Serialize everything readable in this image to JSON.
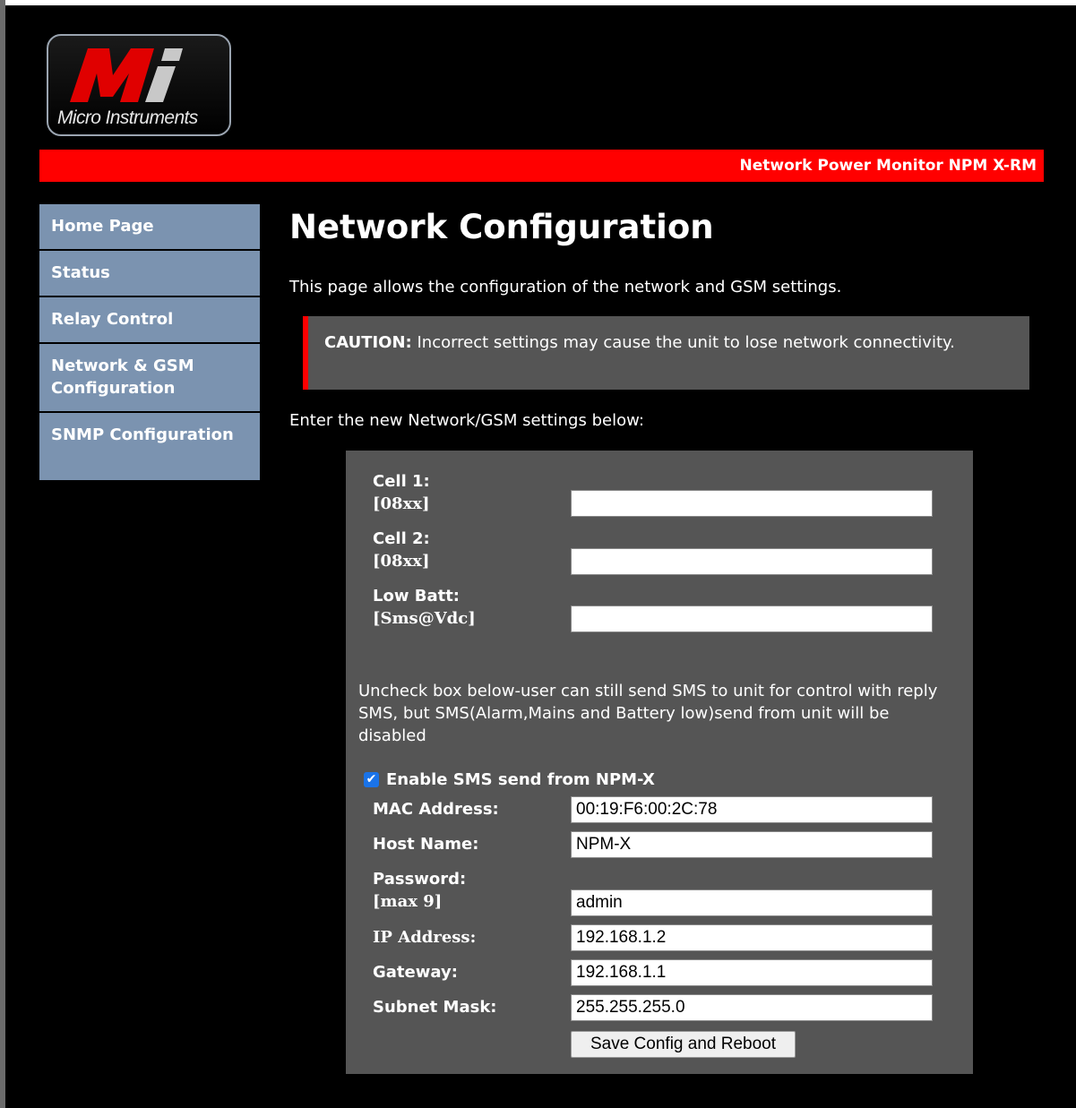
{
  "logo": {
    "mark": "Mi",
    "text": "Micro Instruments"
  },
  "banner": {
    "product": "Network Power Monitor NPM X-RM",
    "color": "#ff0000"
  },
  "nav": {
    "items": [
      {
        "label": "Home Page"
      },
      {
        "label": "Status"
      },
      {
        "label": "Relay Control"
      },
      {
        "label": "Network & GSM Configuration"
      },
      {
        "label": "SNMP Configuration"
      }
    ]
  },
  "main": {
    "title": "Network Configuration",
    "intro": "This page allows the configuration of the network and GSM settings.",
    "caution_label": "CAUTION:",
    "caution_text": " Incorrect settings may cause the unit to lose network connectivity.",
    "prompt": "Enter the new Network/GSM settings below:"
  },
  "form": {
    "cell1": {
      "label": "Cell 1:",
      "hint": "[08xx]",
      "value": ""
    },
    "cell2": {
      "label": "Cell 2:",
      "hint": "[08xx]",
      "value": ""
    },
    "lowbatt": {
      "label": "Low Batt:",
      "hint": "[Sms@Vdc]",
      "value": ""
    },
    "note": "Uncheck box below-user can still send SMS to unit for control with reply SMS, but SMS(Alarm,Mains and Battery low)send from unit will be disabled",
    "sms_enable": {
      "label": "Enable SMS send from NPM-X",
      "checked": true
    },
    "mac": {
      "label": "MAC Address:",
      "value": "00:19:F6:00:2C:78"
    },
    "host": {
      "label": "Host Name:",
      "value": "NPM-X"
    },
    "password": {
      "label": "Password:",
      "hint": "[max 9]",
      "value": "admin"
    },
    "ip": {
      "label": "IP Address:",
      "value": "192.168.1.2"
    },
    "gateway": {
      "label": "Gateway:",
      "value": "192.168.1.1"
    },
    "subnet": {
      "label": "Subnet Mask:",
      "value": "255.255.255.0"
    },
    "submit_label": "Save Config and Reboot"
  }
}
